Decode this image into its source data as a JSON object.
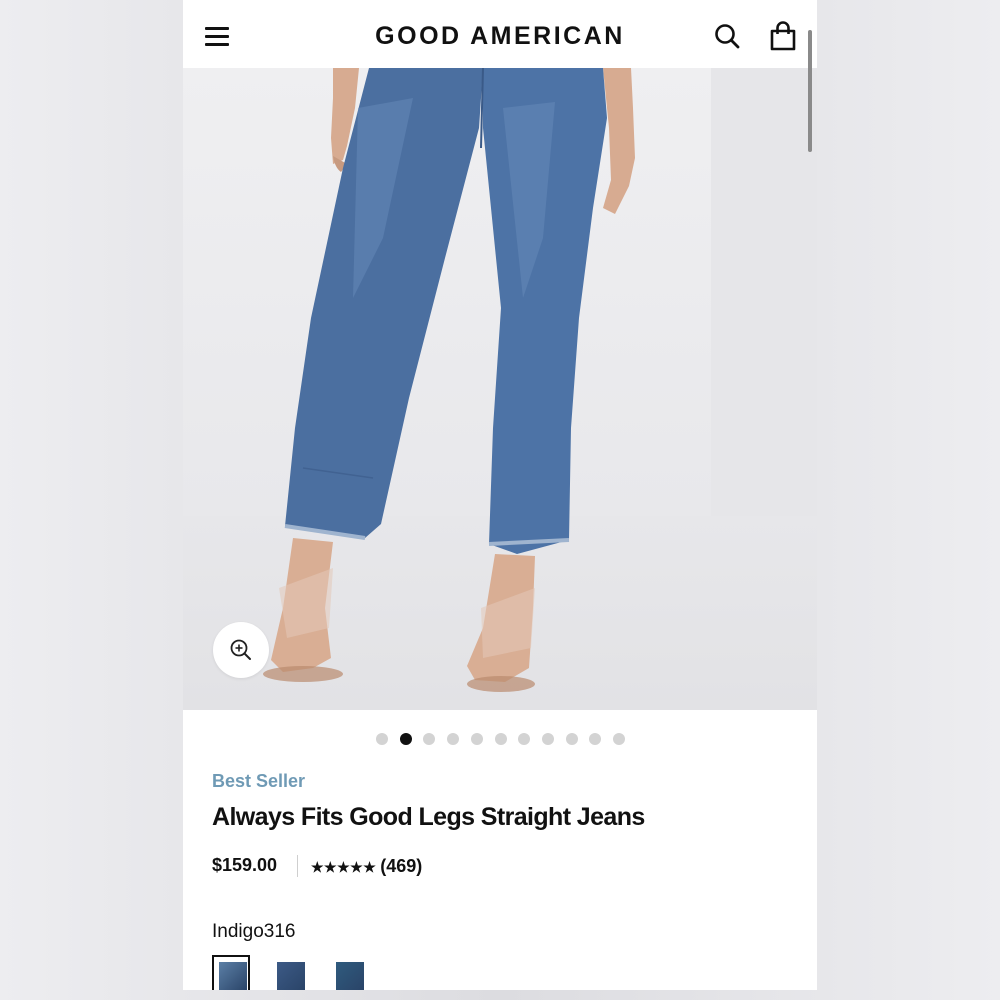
{
  "header": {
    "brand": "GOOD AMERICAN",
    "icons": [
      "menu-icon",
      "search-icon",
      "shopping-bag-icon"
    ]
  },
  "gallery": {
    "slide_count": 11,
    "active_index": 1,
    "zoom_icon": "zoom-in-icon"
  },
  "product": {
    "badge": "Best Seller",
    "title": "Always Fits Good Legs Straight Jeans",
    "price": "$159.00",
    "stars": "★★★★★",
    "review_count": "(469)",
    "color_name": "Indigo316",
    "swatches": [
      {
        "name": "Indigo316",
        "color": "#5b7fa6",
        "selected": true
      },
      {
        "name": "dark-blue",
        "color": "#3c5a86",
        "selected": false
      },
      {
        "name": "dark-teal-blue",
        "color": "#2f5b7e",
        "selected": false
      }
    ]
  },
  "colors": {
    "badge": "#6f9ab5",
    "denim": "#4a6fa3",
    "text": "#111111"
  }
}
